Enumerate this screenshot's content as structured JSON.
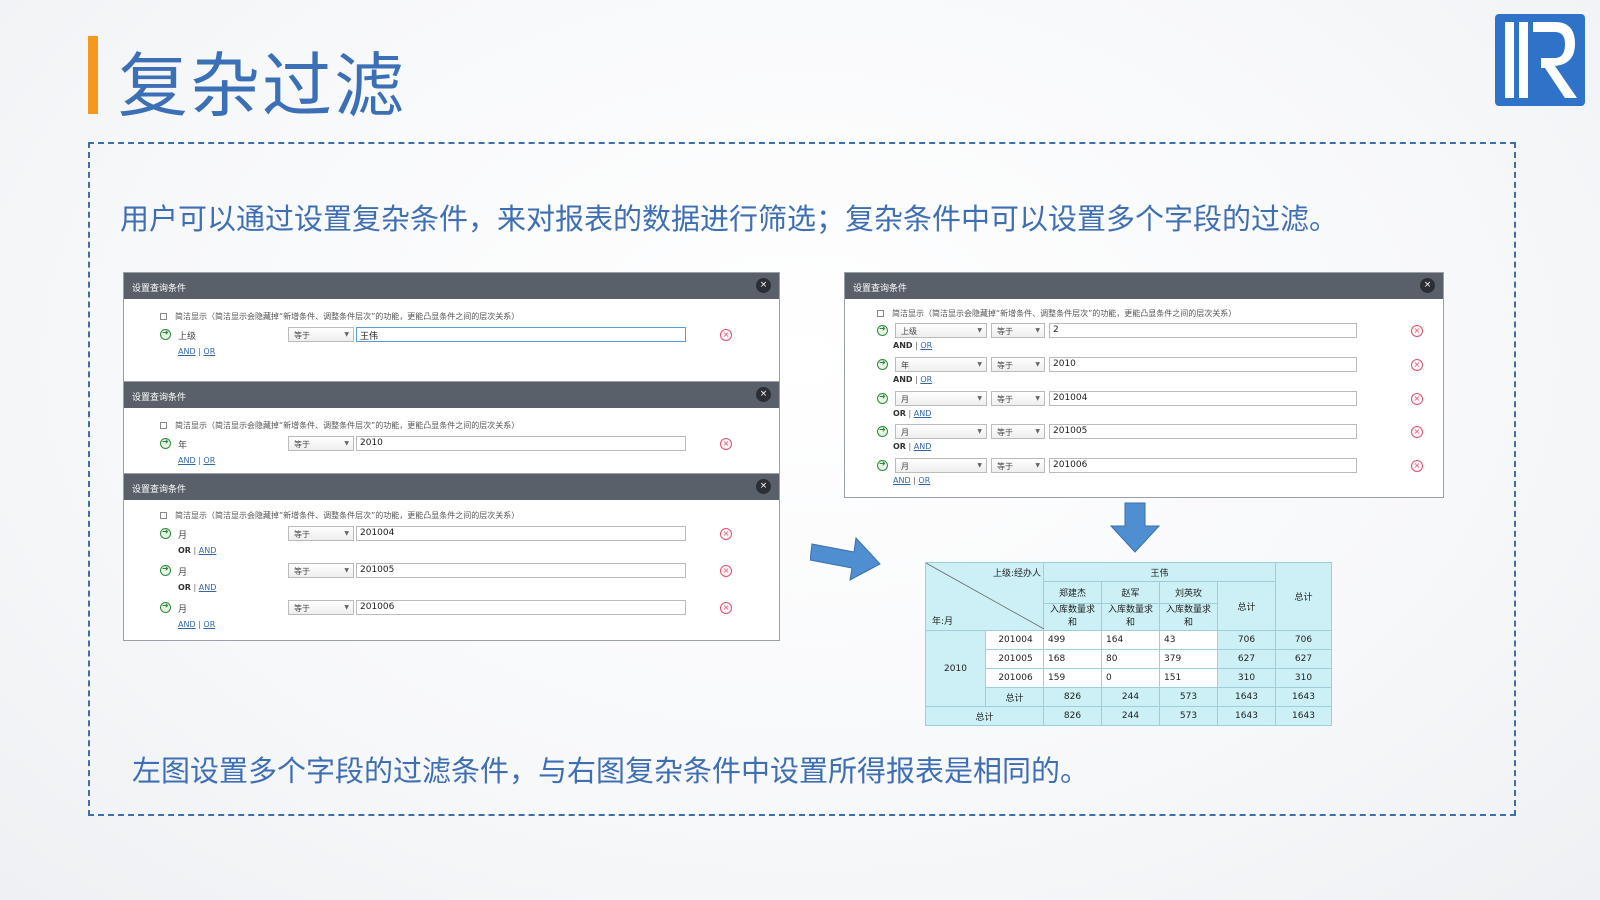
{
  "slide": {
    "title": "复杂过滤",
    "desc": "用户可以通过设置复杂条件，来对报表的数据进行筛选；复杂条件中可以设置多个字段的过滤。",
    "desc2": "左图设置多个字段的过滤条件，与右图复杂条件中设置所得报表是相同的。"
  },
  "colors": {
    "accent": "#f39a1e",
    "brand": "#3b6fb6",
    "frame": "#3f6fa8"
  },
  "dialog": {
    "title": "设置查询条件",
    "close": "×",
    "simple_text": "简洁显示（简洁显示会隐藏掉“新增条件、调整条件层次”的功能，更能凸显条件之间的层次关系）",
    "op": "等于",
    "remove": "×"
  },
  "left_dialogs": [
    {
      "rows": [
        {
          "field": "上级",
          "value": "王伟",
          "logic": [
            "AND",
            "OR"
          ]
        }
      ]
    },
    {
      "rows": [
        {
          "field": "年",
          "value": "2010",
          "logic": [
            "AND",
            "OR"
          ]
        }
      ]
    },
    {
      "rows": [
        {
          "field": "月",
          "value": "201004",
          "logic": [
            "OR",
            "AND"
          ]
        },
        {
          "field": "月",
          "value": "201005",
          "logic": [
            "OR",
            "AND"
          ]
        },
        {
          "field": "月",
          "value": "201006",
          "logic": [
            "AND",
            "OR"
          ]
        }
      ]
    }
  ],
  "right_dialog": {
    "rows": [
      {
        "field": "上级",
        "value": "2",
        "logic": [
          "AND",
          "OR"
        ]
      },
      {
        "field": "年",
        "value": "2010",
        "logic": [
          "AND",
          "OR"
        ]
      },
      {
        "field": "月",
        "value": "201004",
        "logic": [
          "OR",
          "AND"
        ]
      },
      {
        "field": "月",
        "value": "201005",
        "logic": [
          "OR",
          "AND"
        ]
      },
      {
        "field": "月",
        "value": "201006",
        "logic": [
          "AND",
          "OR"
        ]
      }
    ]
  },
  "report": {
    "corner_top": "上级:经办人",
    "corner_bottom": "年:月",
    "manager": "王伟",
    "staff": [
      "郑建杰",
      "赵军",
      "刘英玫"
    ],
    "measure": "入库数量求和",
    "total": "总计",
    "year": "2010",
    "rows": [
      {
        "month": "201004",
        "values": [
          "499",
          "164",
          "43"
        ],
        "sub": "706",
        "grand": "706"
      },
      {
        "month": "201005",
        "values": [
          "168",
          "80",
          "379"
        ],
        "sub": "627",
        "grand": "627"
      },
      {
        "month": "201006",
        "values": [
          "159",
          "0",
          "151"
        ],
        "sub": "310",
        "grand": "310"
      }
    ],
    "year_total": {
      "values": [
        "826",
        "244",
        "573"
      ],
      "sub": "1643",
      "grand": "1643"
    },
    "grand_total": {
      "values": [
        "826",
        "244",
        "573"
      ],
      "sub": "1643",
      "grand": "1643"
    }
  }
}
